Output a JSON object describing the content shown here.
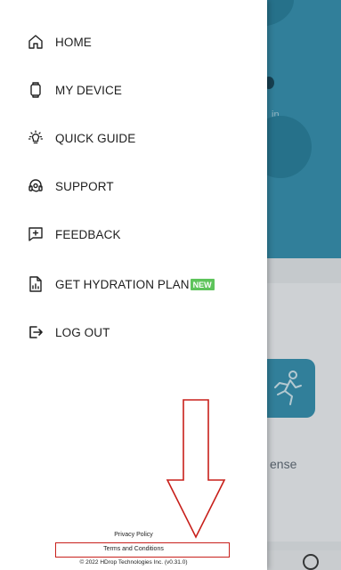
{
  "background": {
    "partial_label_in": "in",
    "partial_label_ense": "ense"
  },
  "drawer": {
    "menu": [
      {
        "label": "HOME",
        "icon": "home-icon"
      },
      {
        "label": "MY DEVICE",
        "icon": "device-icon"
      },
      {
        "label": "QUICK GUIDE",
        "icon": "lightbulb-icon"
      },
      {
        "label": "SUPPORT",
        "icon": "support-headset-icon"
      },
      {
        "label": "FEEDBACK",
        "icon": "feedback-icon"
      },
      {
        "label": "GET HYDRATION PLAN",
        "icon": "document-chart-icon",
        "badge": "NEW"
      },
      {
        "label": "LOG OUT",
        "icon": "logout-icon"
      }
    ],
    "footer": {
      "privacy": "Privacy Policy",
      "terms": "Terms and Conditions",
      "copyright": "© 2022 HDrop Technologies Inc. (v0.31.0)"
    }
  },
  "colors": {
    "accent_blue": "#2f8cab",
    "new_badge": "#5ec45b",
    "annotation_red": "#c8201b"
  }
}
